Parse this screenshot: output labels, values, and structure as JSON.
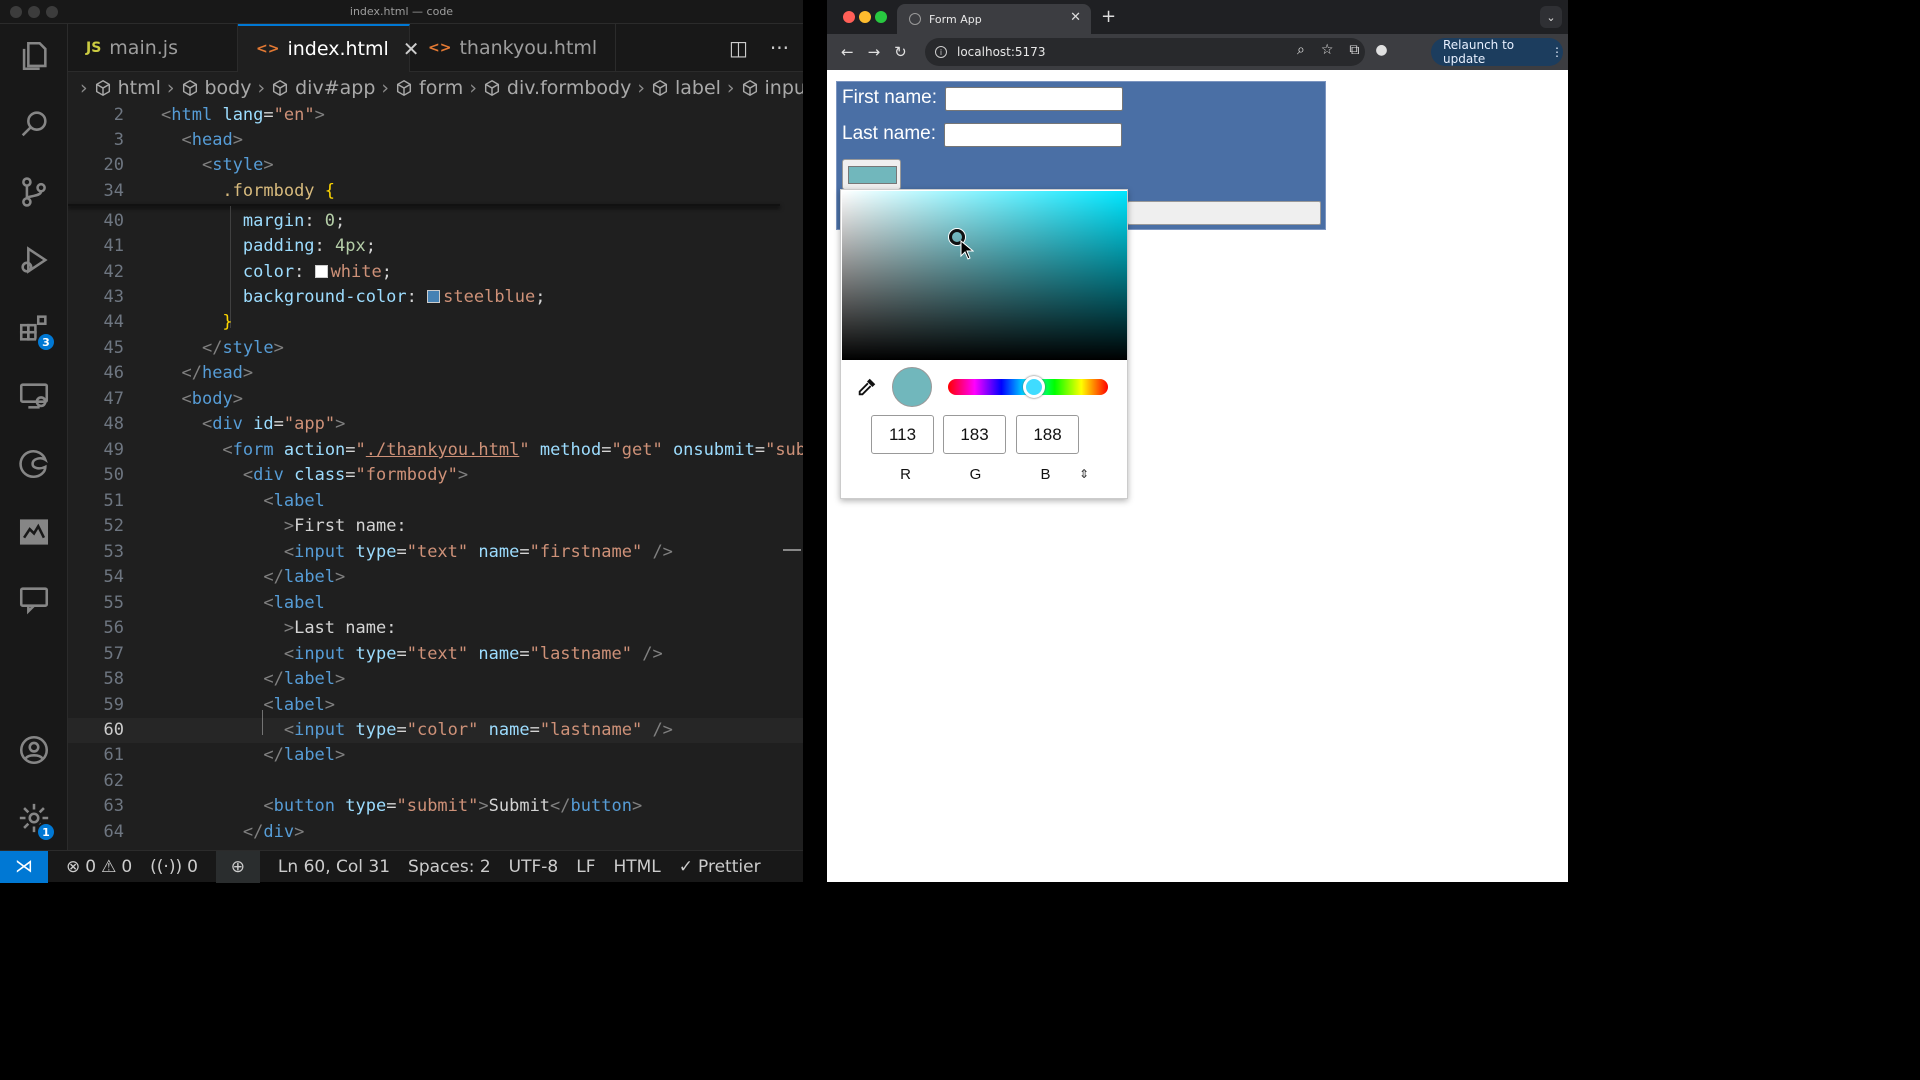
{
  "window": {
    "title": "index.html — code"
  },
  "activity": {
    "extensions_badge": "3",
    "settings_badge": "1"
  },
  "tabs": [
    {
      "icon": "JS",
      "label": "main.js"
    },
    {
      "icon": "<>",
      "label": "index.html"
    },
    {
      "icon": "<>",
      "label": "thankyou.html"
    }
  ],
  "breadcrumb": [
    "html",
    "body",
    "div#app",
    "form",
    "div.formbody",
    "label",
    "input"
  ],
  "status": {
    "errors": "0",
    "warnings": "0",
    "ports": "0",
    "position": "Ln 60, Col 31",
    "spaces": "Spaces: 2",
    "encoding": "UTF-8",
    "eol": "LF",
    "language": "HTML",
    "formatter": "Prettier"
  },
  "colors": {
    "steelblue": "#4682b4",
    "white": "#ffffff",
    "picked": "#71b7bc"
  },
  "browser": {
    "tab_title": "Form App",
    "url": "localhost:5173",
    "relaunch": "Relaunch to update",
    "form": {
      "first_label": "First name:",
      "last_label": "Last name:"
    },
    "picker": {
      "r": "113",
      "g": "183",
      "b": "188",
      "r_label": "R",
      "g_label": "G",
      "b_label": "B"
    }
  }
}
